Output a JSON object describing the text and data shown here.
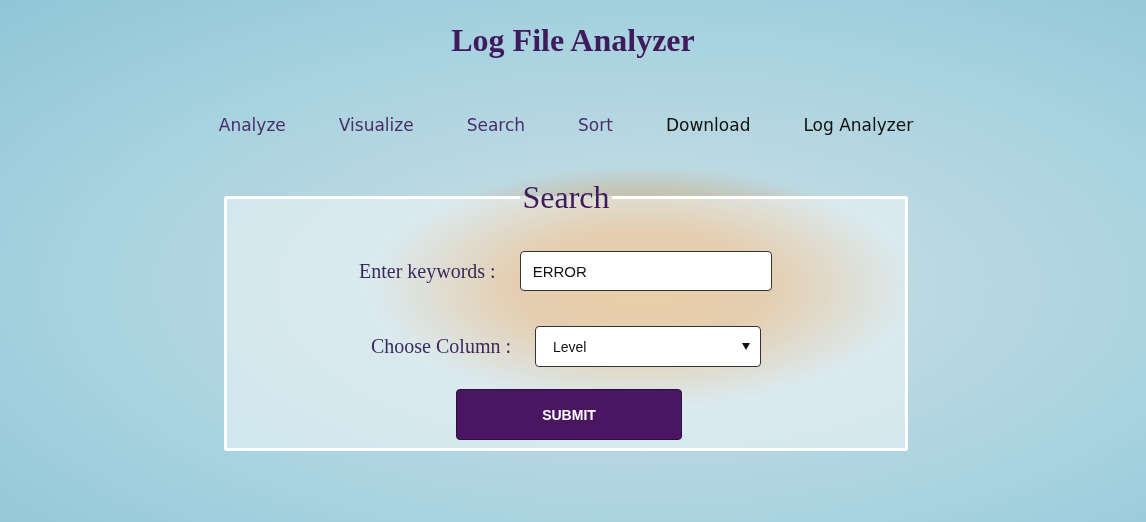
{
  "header": {
    "title": "Log File Analyzer"
  },
  "nav": [
    {
      "label": "Analyze",
      "visited": true
    },
    {
      "label": "Visualize",
      "visited": true
    },
    {
      "label": "Search",
      "visited": true
    },
    {
      "label": "Sort",
      "visited": true
    },
    {
      "label": "Download",
      "visited": false
    },
    {
      "label": "Log Analyzer",
      "visited": false
    }
  ],
  "form": {
    "legend": "Search",
    "keywords": {
      "label": "Enter keywords :",
      "value": "ERROR"
    },
    "column": {
      "label": "Choose Column :",
      "value": "Level"
    },
    "submit": "SUBMIT"
  }
}
